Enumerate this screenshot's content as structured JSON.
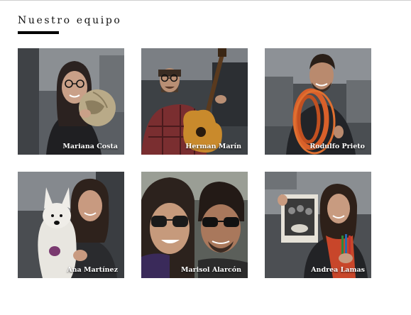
{
  "section": {
    "title": "Nuestro equipo"
  },
  "team": [
    {
      "name": "Mariana Costa"
    },
    {
      "name": "Herman Marín"
    },
    {
      "name": "Rodulfo Prieto"
    },
    {
      "name": "Ana Martínez"
    },
    {
      "name": "Marisol Alarcón"
    },
    {
      "name": "Andrea Lamas"
    }
  ]
}
